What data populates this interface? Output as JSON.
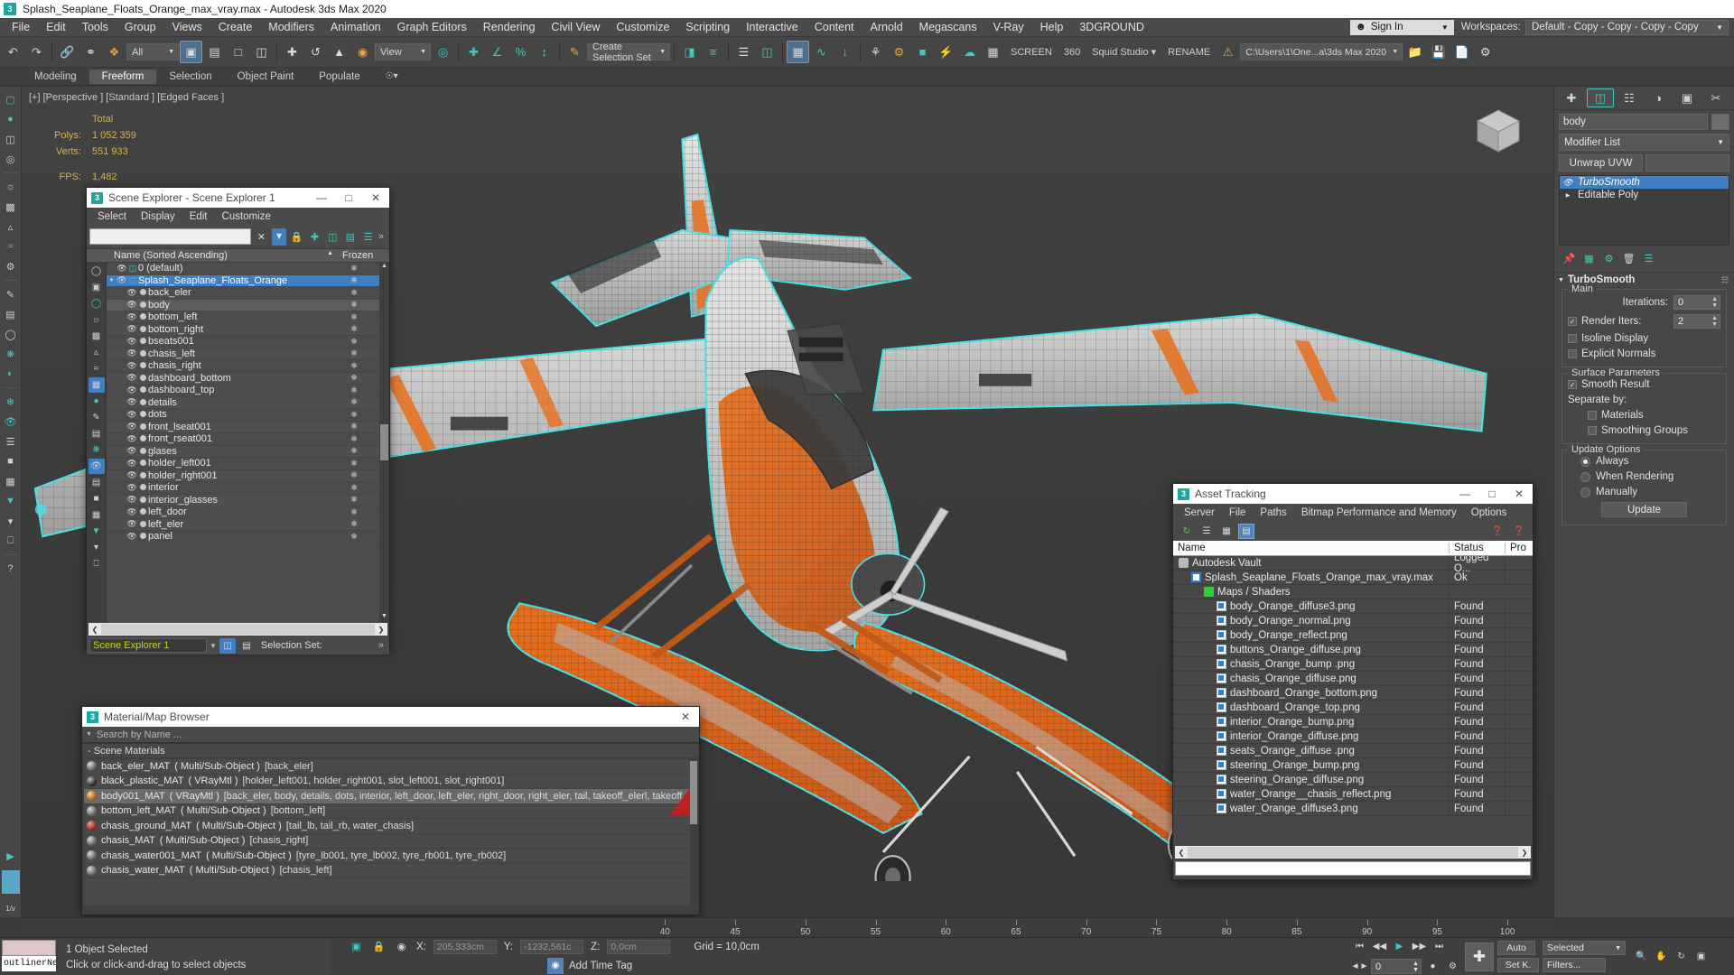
{
  "titlebar": {
    "title": "Splash_Seaplane_Floats_Orange_max_vray.max - Autodesk 3ds Max 2020",
    "logo": "3"
  },
  "menubar": {
    "items": [
      "File",
      "Edit",
      "Tools",
      "Group",
      "Views",
      "Create",
      "Modifiers",
      "Animation",
      "Graph Editors",
      "Rendering",
      "Civil View",
      "Customize",
      "Scripting",
      "Interactive",
      "Content",
      "Arnold",
      "Megascans",
      "V-Ray",
      "Help",
      "3DGROUND"
    ],
    "signin": "Sign In",
    "workspaces_label": "Workspaces:",
    "workspace_value": "Default - Copy - Copy - Copy - Copy"
  },
  "toolbar": {
    "filter_value": "All",
    "view_value": "View",
    "selection_set": "Create Selection Set",
    "screen_label": "SCREEN",
    "frame_value": "360",
    "studio_value": "Squid Studio",
    "rename_label": "RENAME",
    "project_path": "C:\\Users\\1\\One...a\\3ds Max 2020"
  },
  "ribbon": {
    "tabs": [
      "Modeling",
      "Freeform",
      "Selection",
      "Object Paint",
      "Populate"
    ],
    "active": "Freeform"
  },
  "viewport": {
    "label": "[+] [Perspective ] [Standard ] [Edged Faces ]",
    "stats_header": "Total",
    "polys_label": "Polys:",
    "polys_value": "1 052 359",
    "verts_label": "Verts:",
    "verts_value": "551 933",
    "fps_label": "FPS:",
    "fps_value": "1,482"
  },
  "scene_explorer": {
    "title": "Scene Explorer - Scene Explorer 1",
    "menu": [
      "Select",
      "Display",
      "Edit",
      "Customize"
    ],
    "search_value": "",
    "col_name": "Name (Sorted Ascending)",
    "col_frozen": "Frozen",
    "footer_name": "Scene Explorer 1",
    "selection_set_label": "Selection Set:",
    "rows": [
      {
        "label": "0 (default)",
        "indent": 1,
        "type": "layer",
        "state": "normal"
      },
      {
        "label": "Splash_Seaplane_Floats_Orange",
        "indent": 1,
        "type": "group",
        "state": "selected"
      },
      {
        "label": "back_eler",
        "indent": 2,
        "type": "object",
        "state": "normal"
      },
      {
        "label": "body",
        "indent": 2,
        "type": "object",
        "state": "highlight"
      },
      {
        "label": "bottom_left",
        "indent": 2,
        "type": "object",
        "state": "normal"
      },
      {
        "label": "bottom_right",
        "indent": 2,
        "type": "object",
        "state": "normal"
      },
      {
        "label": "bseats001",
        "indent": 2,
        "type": "object",
        "state": "normal"
      },
      {
        "label": "chasis_left",
        "indent": 2,
        "type": "object",
        "state": "normal"
      },
      {
        "label": "chasis_right",
        "indent": 2,
        "type": "object",
        "state": "normal"
      },
      {
        "label": "dashboard_bottom",
        "indent": 2,
        "type": "object",
        "state": "normal"
      },
      {
        "label": "dashboard_top",
        "indent": 2,
        "type": "object",
        "state": "normal"
      },
      {
        "label": "details",
        "indent": 2,
        "type": "object",
        "state": "normal"
      },
      {
        "label": "dots",
        "indent": 2,
        "type": "object",
        "state": "normal"
      },
      {
        "label": "front_lseat001",
        "indent": 2,
        "type": "object",
        "state": "normal"
      },
      {
        "label": "front_rseat001",
        "indent": 2,
        "type": "object",
        "state": "normal"
      },
      {
        "label": "glases",
        "indent": 2,
        "type": "object",
        "state": "normal"
      },
      {
        "label": "holder_left001",
        "indent": 2,
        "type": "object",
        "state": "normal"
      },
      {
        "label": "holder_right001",
        "indent": 2,
        "type": "object",
        "state": "normal"
      },
      {
        "label": "interior",
        "indent": 2,
        "type": "object",
        "state": "normal"
      },
      {
        "label": "interior_glasses",
        "indent": 2,
        "type": "object",
        "state": "normal"
      },
      {
        "label": "left_door",
        "indent": 2,
        "type": "object",
        "state": "normal"
      },
      {
        "label": "left_eler",
        "indent": 2,
        "type": "object",
        "state": "normal"
      },
      {
        "label": "panel",
        "indent": 2,
        "type": "object",
        "state": "normal"
      }
    ]
  },
  "asset_tracking": {
    "title": "Asset Tracking",
    "menu": [
      "Server",
      "File",
      "Paths",
      "Bitmap Performance and Memory",
      "Options"
    ],
    "columns": [
      "Name",
      "Status",
      "Pro"
    ],
    "rows": [
      {
        "name": "Autodesk Vault",
        "status": "Logged O...",
        "icon": "vault",
        "indent": 1
      },
      {
        "name": "Splash_Seaplane_Floats_Orange_max_vray.max",
        "status": "Ok",
        "icon": "max",
        "indent": 2
      },
      {
        "name": "Maps / Shaders",
        "status": "",
        "icon": "maps",
        "indent": 3
      },
      {
        "name": "body_Orange_diffuse3.png",
        "status": "Found",
        "icon": "png",
        "indent": 4
      },
      {
        "name": "body_Orange_normal.png",
        "status": "Found",
        "icon": "png",
        "indent": 4
      },
      {
        "name": "body_Orange_reflect.png",
        "status": "Found",
        "icon": "png",
        "indent": 4
      },
      {
        "name": "buttons_Orange_diffuse.png",
        "status": "Found",
        "icon": "png",
        "indent": 4
      },
      {
        "name": "chasis_Orange_bump .png",
        "status": "Found",
        "icon": "png",
        "indent": 4
      },
      {
        "name": "chasis_Orange_diffuse.png",
        "status": "Found",
        "icon": "png",
        "indent": 4
      },
      {
        "name": "dashboard_Orange_bottom.png",
        "status": "Found",
        "icon": "png",
        "indent": 4
      },
      {
        "name": "dashboard_Orange_top.png",
        "status": "Found",
        "icon": "png",
        "indent": 4
      },
      {
        "name": "interior_Orange_bump.png",
        "status": "Found",
        "icon": "png",
        "indent": 4
      },
      {
        "name": "interior_Orange_diffuse.png",
        "status": "Found",
        "icon": "png",
        "indent": 4
      },
      {
        "name": "seats_Orange_diffuse .png",
        "status": "Found",
        "icon": "png",
        "indent": 4
      },
      {
        "name": "steering_Orange_bump.png",
        "status": "Found",
        "icon": "png",
        "indent": 4
      },
      {
        "name": "steering_Orange_diffuse.png",
        "status": "Found",
        "icon": "png",
        "indent": 4
      },
      {
        "name": "water_Orange__chasis_reflect.png",
        "status": "Found",
        "icon": "png",
        "indent": 4
      },
      {
        "name": "water_Orange_diffuse3.png",
        "status": "Found",
        "icon": "png",
        "indent": 4
      }
    ]
  },
  "material_browser": {
    "title": "Material/Map Browser",
    "search_placeholder": "Search by Name ...",
    "group_label": "- Scene Materials",
    "rows": [
      {
        "name": "back_eler_MAT",
        "type": "( Multi/Sub-Object )",
        "objects": "[back_eler]",
        "swatch": "light",
        "selected": false
      },
      {
        "name": "black_plastic_MAT",
        "type": "( VRayMtl )",
        "objects": "[holder_left001, holder_right001, slot_left001, slot_right001]",
        "swatch": "dark",
        "selected": false
      },
      {
        "name": "body001_MAT",
        "type": "( VRayMtl )",
        "objects": "[back_eler, body, details, dots, interior, left_door, left_eler, right_door, right_eler, tail, takeoff_elerl, takeoff_elerr]",
        "swatch": "org",
        "selected": true
      },
      {
        "name": "bottom_left_MAT",
        "type": "( Multi/Sub-Object )",
        "objects": "[bottom_left]",
        "swatch": "light",
        "selected": false
      },
      {
        "name": "chasis_ground_MAT",
        "type": "( Multi/Sub-Object )",
        "objects": "[tail_lb, tail_rb, water_chasis]",
        "swatch": "red",
        "selected": false
      },
      {
        "name": "chasis_MAT",
        "type": "( Multi/Sub-Object )",
        "objects": "[chasis_right]",
        "swatch": "light",
        "selected": false
      },
      {
        "name": "chasis_water001_MAT",
        "type": "( Multi/Sub-Object )",
        "objects": "[tyre_lb001, tyre_lb002, tyre_rb001, tyre_rb002]",
        "swatch": "light",
        "selected": false
      },
      {
        "name": "chasis_water_MAT",
        "type": "( Multi/Sub-Object )",
        "objects": "[chasis_left]",
        "swatch": "light",
        "selected": false
      }
    ]
  },
  "command_panel": {
    "object_name": "body",
    "modifier_list": "Modifier List",
    "unwrap_uvw": "Unwrap UVW",
    "stack": [
      {
        "label": "TurboSmooth",
        "active": true
      },
      {
        "label": "Editable Poly",
        "active": false
      }
    ],
    "rollup_title": "TurboSmooth",
    "main_legend": "Main",
    "iterations_label": "Iterations:",
    "iterations_value": "0",
    "render_iters_label": "Render Iters:",
    "render_iters_value": "2",
    "render_iters_checked": true,
    "isoline_label": "Isoline Display",
    "isoline_checked": false,
    "explicit_normals_label": "Explicit Normals",
    "explicit_normals_checked": false,
    "surface_legend": "Surface Parameters",
    "smooth_result_label": "Smooth Result",
    "smooth_result_checked": true,
    "separate_by_label": "Separate by:",
    "materials_label": "Materials",
    "materials_checked": false,
    "smoothing_groups_label": "Smoothing Groups",
    "smoothing_groups_checked": false,
    "update_legend": "Update Options",
    "update_options": [
      {
        "label": "Always",
        "selected": true
      },
      {
        "label": "When Rendering",
        "selected": false
      },
      {
        "label": "Manually",
        "selected": false
      }
    ],
    "update_button": "Update"
  },
  "timeline": {
    "ticks": [
      "40",
      "45",
      "50",
      "55",
      "60",
      "65",
      "70",
      "75",
      "80",
      "85",
      "90",
      "95",
      "100"
    ]
  },
  "statusbar": {
    "mini_name": "outlinerNeste",
    "message_primary": "1 Object Selected",
    "message_secondary": "Click or click-and-drag to select objects",
    "x_label": "X:",
    "x_value": "205,333cm",
    "y_label": "Y:",
    "y_value": "-1232,561c",
    "z_label": "Z:",
    "z_value": "0,0cm",
    "grid_label": "Grid = 10,0cm",
    "add_time_tag": "Add Time Tag",
    "time_value": "0",
    "auto_label": "Auto",
    "key_label": "Selected",
    "setkey_label": "Set K.",
    "filters_label": "Filters..."
  }
}
